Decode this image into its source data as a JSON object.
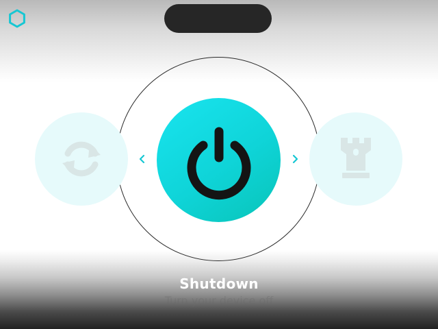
{
  "brand": {
    "icon": "hexagon-logo-icon",
    "color": "#16c7d3"
  },
  "top_bar": {
    "icon": "notch-pill"
  },
  "carousel": {
    "prev_icon": "chevron-left-icon",
    "next_icon": "chevron-right-icon",
    "accent_color": "#16c7d3",
    "items": [
      {
        "icon": "refresh-icon",
        "selected": false
      },
      {
        "icon": "power-icon",
        "selected": true
      },
      {
        "icon": "rook-tower-icon",
        "selected": false
      }
    ]
  },
  "selected": {
    "title": "Shutdown",
    "subtitle": "Turn your device off"
  }
}
